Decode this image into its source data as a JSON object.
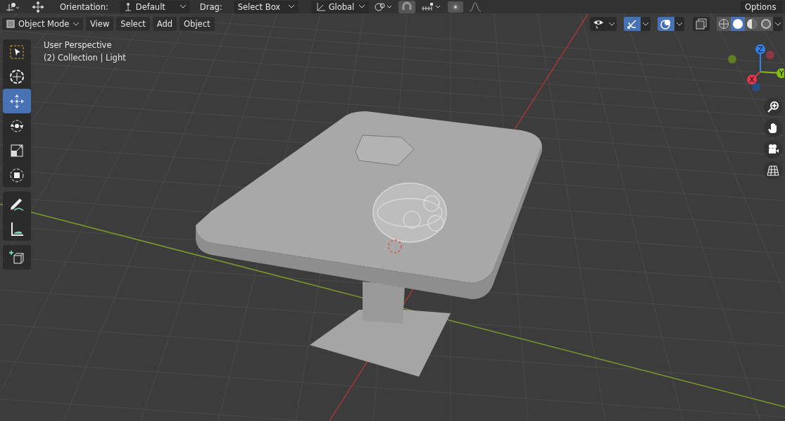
{
  "header": {
    "orientation_label": "Orientation:",
    "orientation": "Default",
    "drag_label": "Drag:",
    "drag": "Select Box",
    "transform_orientation": "Global",
    "snap_on": false,
    "proportional_on": false,
    "options": "Options"
  },
  "mode": "Object Mode",
  "menus": [
    "View",
    "Select",
    "Add",
    "Object"
  ],
  "viewport_toggles": [
    {
      "kind": "visibility",
      "on": false
    },
    {
      "kind": "gizmo",
      "on": true
    },
    {
      "kind": "overlay",
      "on": true
    },
    {
      "kind": "xray",
      "on": false
    }
  ],
  "shading": [
    {
      "kind": "wireframe",
      "selected": false
    },
    {
      "kind": "solid",
      "selected": true
    },
    {
      "kind": "material",
      "selected": false
    },
    {
      "kind": "rendered",
      "selected": false
    }
  ],
  "overlay_text": [
    "User Perspective",
    "(2) Collection | Light"
  ],
  "tool_groups": [
    [
      {
        "kind": "select",
        "selected": false
      },
      {
        "kind": "cursor",
        "selected": false
      },
      {
        "kind": "move",
        "selected": true
      },
      {
        "kind": "rotate",
        "selected": false
      },
      {
        "kind": "scale",
        "selected": false
      },
      {
        "kind": "transform",
        "selected": false
      }
    ],
    [
      {
        "kind": "annotate",
        "selected": false
      },
      {
        "kind": "measure",
        "selected": false
      }
    ],
    [
      {
        "kind": "add-cube",
        "selected": false
      }
    ]
  ],
  "gizmo_axes": [
    "X",
    "Y",
    "Z"
  ],
  "nav": [
    {
      "kind": "zoom"
    },
    {
      "kind": "pan"
    },
    {
      "kind": "camera"
    },
    {
      "kind": "ortho"
    }
  ]
}
